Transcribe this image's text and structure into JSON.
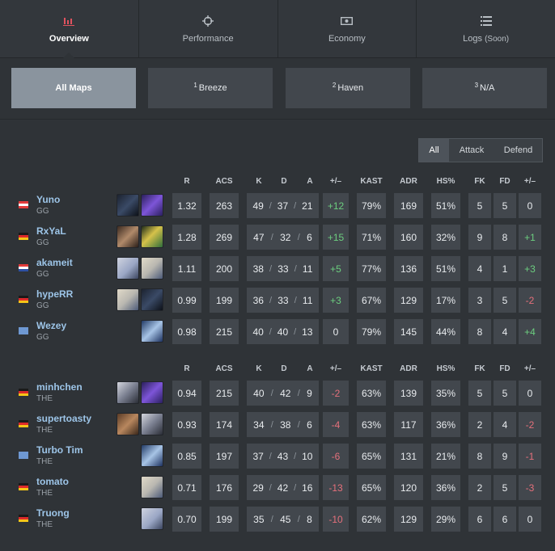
{
  "tabs": [
    {
      "label": "Overview",
      "icon": "bar-chart-icon",
      "active": true
    },
    {
      "label": "Performance",
      "icon": "crosshair-icon",
      "active": false
    },
    {
      "label": "Economy",
      "icon": "money-icon",
      "active": false
    },
    {
      "label": "Logs",
      "suffix": "(Soon)",
      "icon": "list-icon",
      "active": false
    }
  ],
  "maps": [
    {
      "num": "",
      "label": "All Maps",
      "active": true
    },
    {
      "num": "1",
      "label": "Breeze",
      "active": false
    },
    {
      "num": "2",
      "label": "Haven",
      "active": false
    },
    {
      "num": "3",
      "label": "N/A",
      "active": false
    }
  ],
  "side_filter": [
    "All",
    "Attack",
    "Defend"
  ],
  "headers": [
    "R",
    "ACS",
    "K",
    "D",
    "A",
    "+/–",
    "KAST",
    "ADR",
    "HS%",
    "FK",
    "FD",
    "+/–"
  ],
  "teams": [
    {
      "players": [
        {
          "name": "Yuno",
          "team": "GG",
          "flag": "at",
          "agents": [
            "omen",
            "reyna"
          ],
          "r": "1.32",
          "acs": "263",
          "k": "49",
          "d": "37",
          "a": "21",
          "kd_diff": "+12",
          "kast": "79%",
          "adr": "169",
          "hs": "51%",
          "fk": "5",
          "fd": "5",
          "fk_diff": "0"
        },
        {
          "name": "RxYaL",
          "team": "GG",
          "flag": "de",
          "agents": [
            "chamber",
            "killjoy"
          ],
          "r": "1.28",
          "acs": "269",
          "k": "47",
          "d": "32",
          "a": "6",
          "kd_diff": "+15",
          "kast": "71%",
          "adr": "160",
          "hs": "32%",
          "fk": "9",
          "fd": "8",
          "fk_diff": "+1"
        },
        {
          "name": "akameit",
          "team": "GG",
          "flag": "hr",
          "agents": [
            "sage",
            "sova"
          ],
          "r": "1.11",
          "acs": "200",
          "k": "38",
          "d": "33",
          "a": "11",
          "kd_diff": "+5",
          "kast": "77%",
          "adr": "136",
          "hs": "51%",
          "fk": "4",
          "fd": "1",
          "fk_diff": "+3"
        },
        {
          "name": "hypeRR",
          "team": "GG",
          "flag": "de",
          "agents": [
            "sova",
            "omen"
          ],
          "r": "0.99",
          "acs": "199",
          "k": "36",
          "d": "33",
          "a": "11",
          "kd_diff": "+3",
          "kast": "67%",
          "adr": "129",
          "hs": "17%",
          "fk": "3",
          "fd": "5",
          "fk_diff": "-2"
        },
        {
          "name": "Wezey",
          "team": "GG",
          "flag": "un",
          "agents": [
            "jett"
          ],
          "r": "0.98",
          "acs": "215",
          "k": "40",
          "d": "40",
          "a": "13",
          "kd_diff": "0",
          "kast": "79%",
          "adr": "145",
          "hs": "44%",
          "fk": "8",
          "fd": "4",
          "fk_diff": "+4"
        }
      ]
    },
    {
      "players": [
        {
          "name": "minhchen",
          "team": "THE",
          "flag": "de",
          "agents": [
            "cypher",
            "reyna"
          ],
          "r": "0.94",
          "acs": "215",
          "k": "40",
          "d": "42",
          "a": "9",
          "kd_diff": "-2",
          "kast": "63%",
          "adr": "139",
          "hs": "35%",
          "fk": "5",
          "fd": "5",
          "fk_diff": "0"
        },
        {
          "name": "supertoasty",
          "team": "THE",
          "flag": "de",
          "agents": [
            "brimstone",
            "cypher"
          ],
          "r": "0.93",
          "acs": "174",
          "k": "34",
          "d": "38",
          "a": "6",
          "kd_diff": "-4",
          "kast": "63%",
          "adr": "117",
          "hs": "36%",
          "fk": "2",
          "fd": "4",
          "fk_diff": "-2"
        },
        {
          "name": "Turbo Tim",
          "team": "THE",
          "flag": "un",
          "agents": [
            "jett"
          ],
          "r": "0.85",
          "acs": "197",
          "k": "37",
          "d": "43",
          "a": "10",
          "kd_diff": "-6",
          "kast": "65%",
          "adr": "131",
          "hs": "21%",
          "fk": "8",
          "fd": "9",
          "fk_diff": "-1"
        },
        {
          "name": "tomato",
          "team": "THE",
          "flag": "de",
          "agents": [
            "sova"
          ],
          "r": "0.71",
          "acs": "176",
          "k": "29",
          "d": "42",
          "a": "16",
          "kd_diff": "-13",
          "kast": "65%",
          "adr": "120",
          "hs": "36%",
          "fk": "2",
          "fd": "5",
          "fk_diff": "-3"
        },
        {
          "name": "Truong",
          "team": "THE",
          "flag": "de",
          "agents": [
            "sage"
          ],
          "r": "0.70",
          "acs": "199",
          "k": "35",
          "d": "45",
          "a": "8",
          "kd_diff": "-10",
          "kast": "62%",
          "adr": "129",
          "hs": "29%",
          "fk": "6",
          "fd": "6",
          "fk_diff": "0"
        }
      ]
    }
  ],
  "colors": {
    "positive": "#6cce7f",
    "negative": "#e4707b",
    "name": "#9dc5e8",
    "cell_bg": "#42474d",
    "active_map": "#8a949e"
  }
}
